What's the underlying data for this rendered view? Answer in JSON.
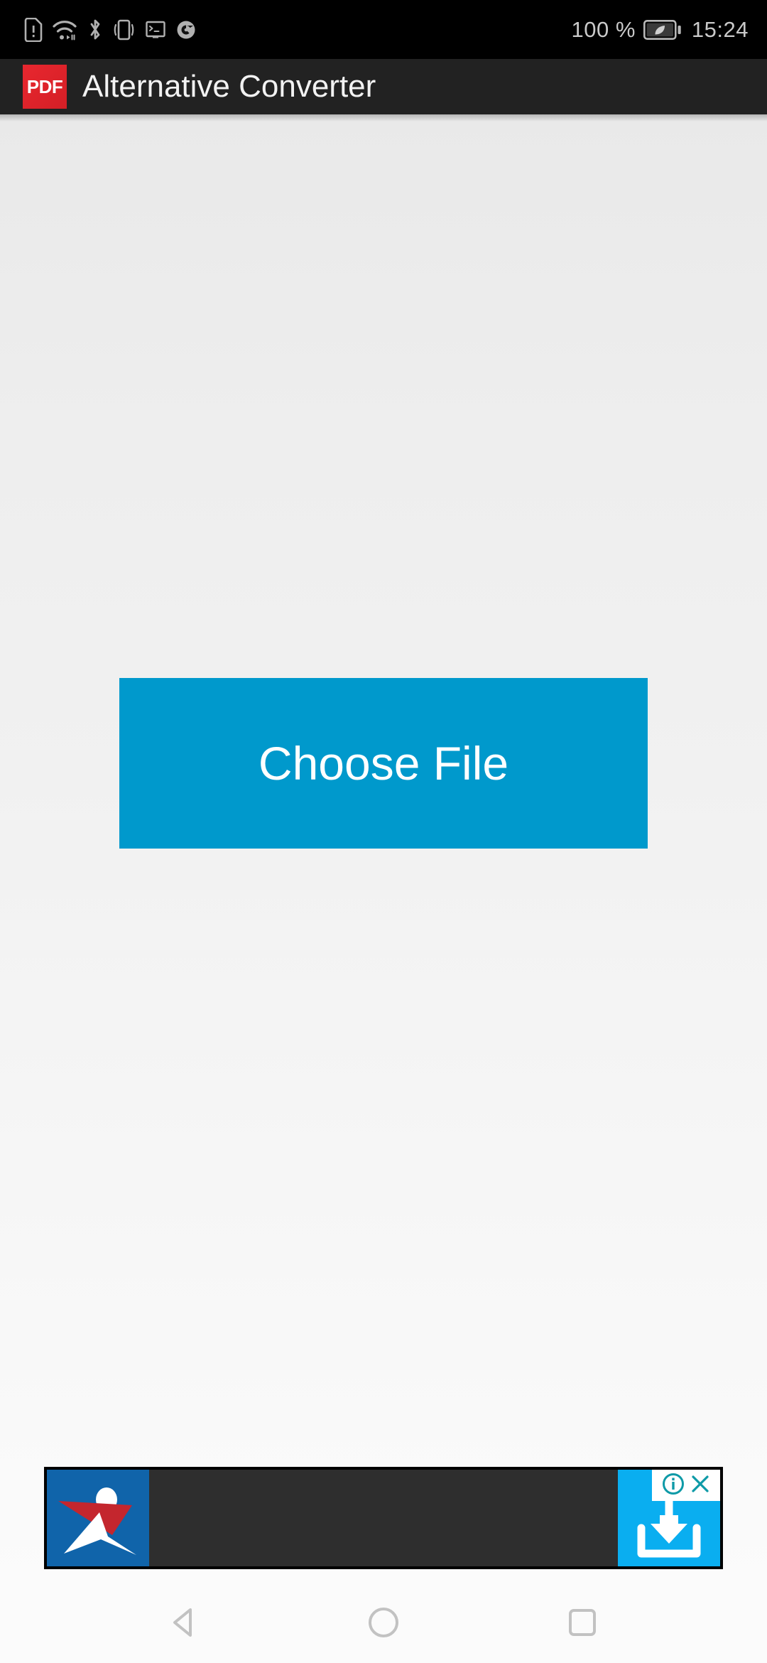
{
  "status_bar": {
    "left_icons": [
      {
        "name": "sim-card-alert-icon",
        "label": "SIM card alert"
      },
      {
        "name": "wifi-icon",
        "label": "Wi-Fi connected"
      },
      {
        "name": "bluetooth-icon",
        "label": "Bluetooth on"
      },
      {
        "name": "vibrate-icon",
        "label": "Vibrate mode"
      },
      {
        "name": "terminal-notification-icon",
        "label": "Terminal"
      },
      {
        "name": "chrome-notification-icon",
        "label": "Chrome"
      }
    ],
    "battery_percent": "100 %",
    "battery_mode": "power-saving-leaf",
    "clock": "15:24",
    "background_color": "#000000",
    "text_color": "#c9c9c9"
  },
  "app_bar": {
    "logo_text": "PDF",
    "logo_color": "#E3222A",
    "title": "Alternative Converter",
    "background_color": "#222222",
    "title_color": "#f2f2f2"
  },
  "main": {
    "primary_button": {
      "label": "Choose File",
      "background_color": "#0099CC",
      "text_color": "#FFFFFF"
    },
    "background_top_color": "#e9e9e9",
    "background_bottom_color": "#fbfbfb"
  },
  "ad_banner": {
    "advertiser_logo": {
      "name": "advertiser-logo",
      "background_color": "#1064AA",
      "accent_color": "#C4262E"
    },
    "body_background_color": "#2e2e2e",
    "cta": {
      "name": "install-download-icon",
      "background_color": "#0AAEF0",
      "icon": "download-to-tray"
    },
    "info_badge": {
      "info_label": "i",
      "close_label": "X",
      "badge_color": "#ffffff",
      "glyph_color": "#0E9AA7"
    }
  },
  "nav_bar": {
    "background_color": "#fbfbfb",
    "icon_color": "#c2c2c2",
    "buttons": [
      {
        "name": "nav-back-button",
        "label": "Back"
      },
      {
        "name": "nav-home-button",
        "label": "Home"
      },
      {
        "name": "nav-recents-button",
        "label": "Recents"
      }
    ]
  }
}
